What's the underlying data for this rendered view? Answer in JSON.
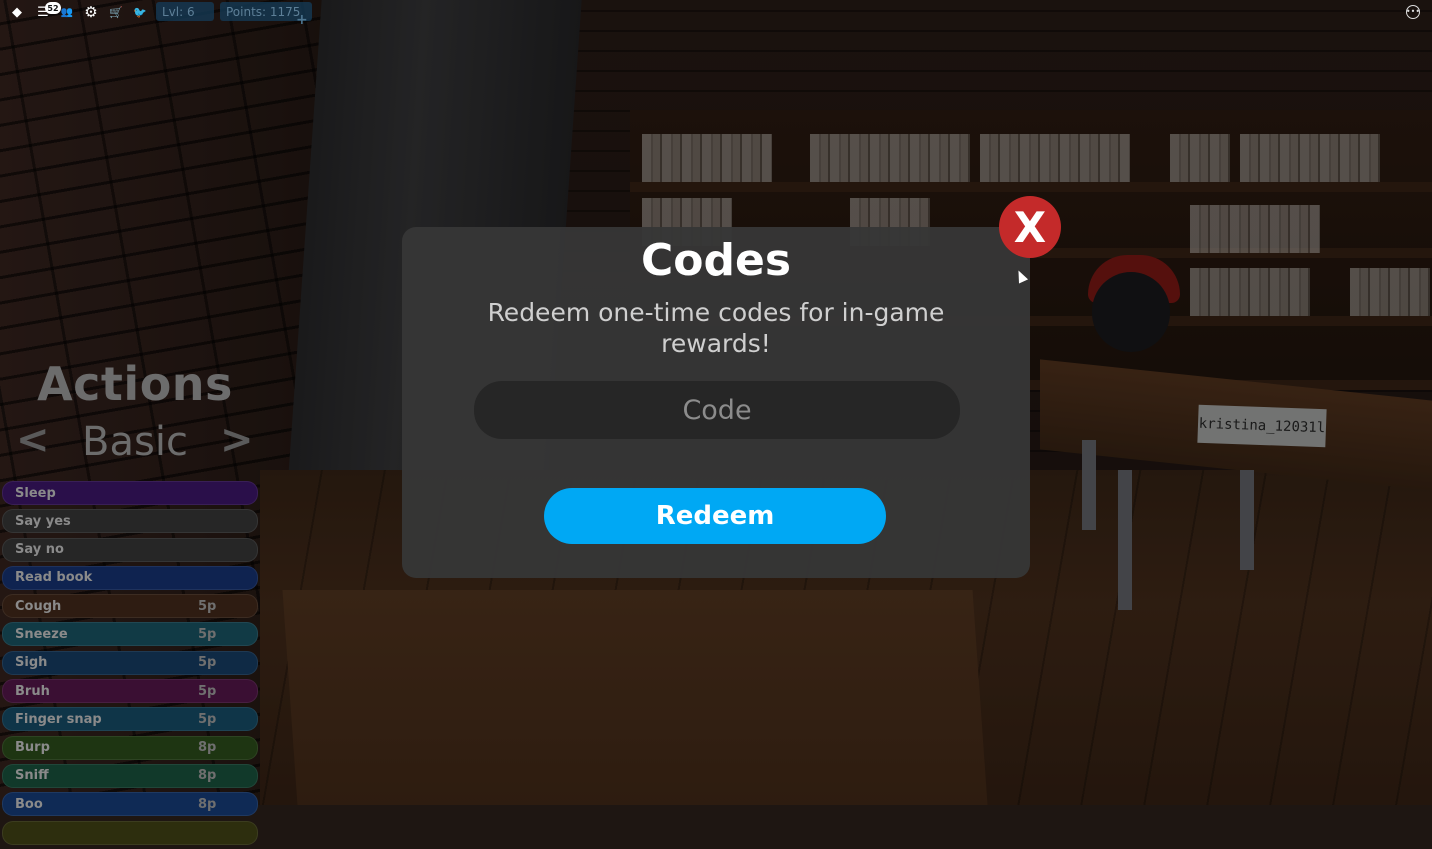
{
  "topbar": {
    "icons": [
      {
        "name": "roblox-logo-icon",
        "glyph": "◆"
      },
      {
        "name": "chat-icon",
        "glyph": "☰"
      },
      {
        "name": "players-icon",
        "glyph": "👥"
      },
      {
        "name": "settings-gear-icon",
        "glyph": "⚙"
      },
      {
        "name": "shop-cart-icon",
        "glyph": "🛒"
      },
      {
        "name": "twitter-icon",
        "glyph": "🐦"
      }
    ],
    "chat_badge": "52",
    "level": "Lvl: 6",
    "points": "Points: 1175",
    "add_points": "+",
    "menu_glyph": "•••"
  },
  "actions": {
    "title": "Actions",
    "category": "Basic",
    "prev": "<",
    "next": ">",
    "items": [
      {
        "label": "Sleep",
        "cost": "",
        "color": "#2a0f4a"
      },
      {
        "label": "Say yes",
        "cost": "",
        "color": "#262626"
      },
      {
        "label": "Say no",
        "cost": "",
        "color": "#262626"
      },
      {
        "label": "Read book",
        "cost": "",
        "color": "#0f2350"
      },
      {
        "label": "Cough",
        "cost": "5p",
        "color": "#2e1c12"
      },
      {
        "label": "Sneeze",
        "cost": "5p",
        "color": "#113a45"
      },
      {
        "label": "Sigh",
        "cost": "5p",
        "color": "#0f2a45"
      },
      {
        "label": "Bruh",
        "cost": "5p",
        "color": "#3a0f33"
      },
      {
        "label": "Finger snap",
        "cost": "5p",
        "color": "#0f3548"
      },
      {
        "label": "Burp",
        "cost": "8p",
        "color": "#1e3512"
      },
      {
        "label": "Sniff",
        "cost": "8p",
        "color": "#11392a"
      },
      {
        "label": "Boo",
        "cost": "8p",
        "color": "#0f2a55"
      },
      {
        "label": "",
        "cost": "",
        "color": "#2d2e0e"
      }
    ]
  },
  "codes_modal": {
    "title": "Codes",
    "description": "Redeem one-time codes for in-game rewards!",
    "input_placeholder": "Code",
    "input_value": "",
    "redeem_label": "Redeem",
    "close_label": "X",
    "accent_color": "#00a8f4",
    "close_color": "#c42a2a"
  },
  "scene": {
    "name_tag": "kristina_12031l"
  }
}
